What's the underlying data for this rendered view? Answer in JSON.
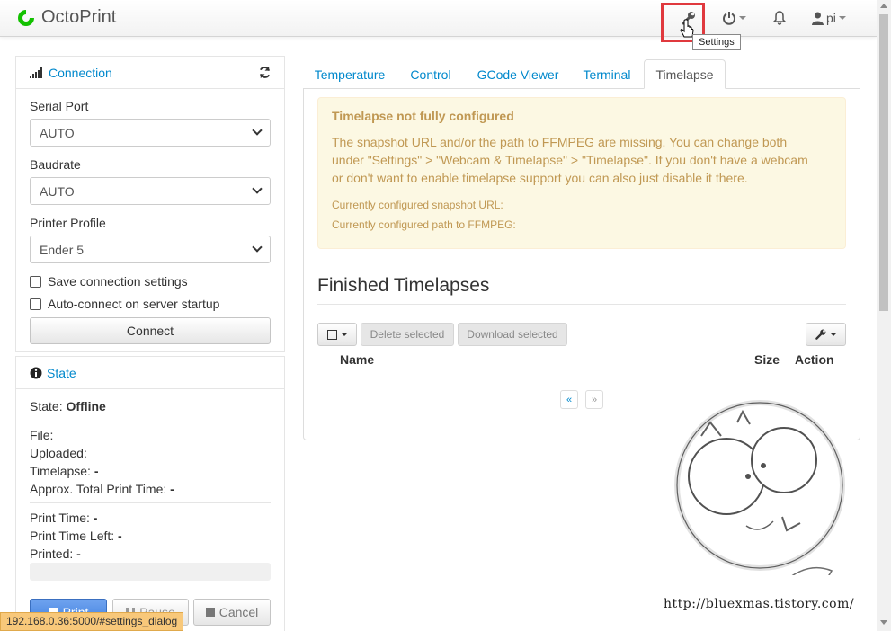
{
  "navbar": {
    "brand": "OctoPrint",
    "user": "pi",
    "tooltip": "Settings"
  },
  "sidebar": {
    "connection": {
      "title": "Connection",
      "serial_port_label": "Serial Port",
      "serial_port_value": "AUTO",
      "baudrate_label": "Baudrate",
      "baudrate_value": "AUTO",
      "profile_label": "Printer Profile",
      "profile_value": "Ender 5",
      "save_settings_label": "Save connection settings",
      "autoconnect_label": "Auto-connect on server startup",
      "connect_label": "Connect"
    },
    "state": {
      "title": "State",
      "state_label": "State:",
      "state_value": "Offline",
      "file_label": "File:",
      "uploaded_label": "Uploaded:",
      "timelapse_label": "Timelapse:",
      "timelapse_value": "-",
      "approx_label": "Approx. Total Print Time:",
      "approx_value": "-",
      "print_time_label": "Print Time:",
      "print_time_value": "-",
      "time_left_label": "Print Time Left:",
      "time_left_value": "-",
      "printed_label": "Printed:",
      "printed_value": "-",
      "print_btn": "Print",
      "pause_btn": "Pause",
      "cancel_btn": "Cancel"
    }
  },
  "status_url": "192.168.0.36:5000/#settings_dialog",
  "tabs": [
    "Temperature",
    "Control",
    "GCode Viewer",
    "Terminal",
    "Timelapse"
  ],
  "timelapse": {
    "alert_title": "Timelapse not fully configured",
    "alert_body": "The snapshot URL and/or the path to FFMPEG are missing. You can change both under \"Settings\" > \"Webcam & Timelapse\" > \"Timelapse\". If you don't have a webcam or don't want to enable timelapse support you can also just disable it there.",
    "snapshot_line": "Currently configured snapshot URL:",
    "ffmpeg_line": "Currently configured path to FFMPEG:",
    "finished_title": "Finished Timelapses",
    "delete_selected": "Delete selected",
    "download_selected": "Download selected",
    "col_name": "Name",
    "col_size": "Size",
    "col_action": "Action",
    "page_prev": "«",
    "page_next": "»"
  },
  "watermark": "http://bluexmas.tistory.com/",
  "colors": {
    "link": "#0088cc",
    "alert_bg": "#fcf8e3",
    "alert_text": "#c09853",
    "highlight": "#e0393e"
  }
}
